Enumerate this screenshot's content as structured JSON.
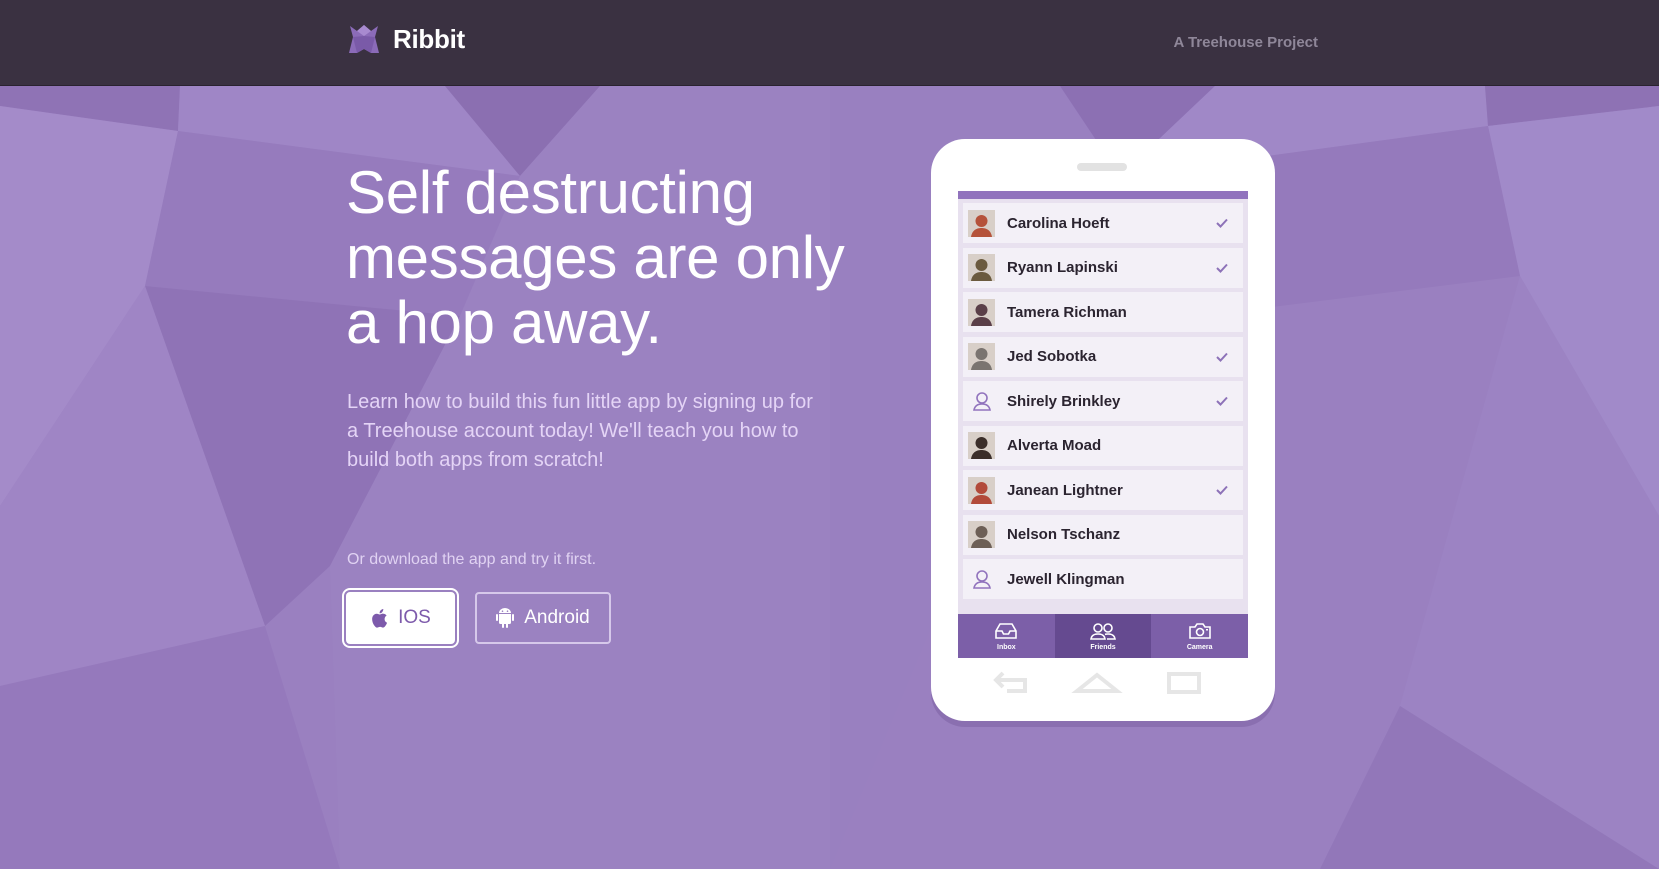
{
  "header": {
    "brand": "Ribbit",
    "tagline": "A Treehouse Project"
  },
  "hero": {
    "title": "Self destructing messages are only a hop away.",
    "description": "Learn how to build this fun little app by signing up for a Treehouse account today! We'll teach you how to build both apps from scratch!",
    "download_text": "Or download the app and try it first."
  },
  "buttons": {
    "ios": "IOS",
    "android": "Android"
  },
  "phone": {
    "contacts": [
      {
        "name": "Carolina Hoeft",
        "checked": true,
        "avatar": "photo",
        "color": "#b5523a"
      },
      {
        "name": "Ryann Lapinski",
        "checked": true,
        "avatar": "photo",
        "color": "#6b5a3e"
      },
      {
        "name": "Tamera Richman",
        "checked": false,
        "avatar": "photo",
        "color": "#5a3f48"
      },
      {
        "name": "Jed Sobotka",
        "checked": true,
        "avatar": "photo",
        "color": "#7a7470"
      },
      {
        "name": "Shirely Brinkley",
        "checked": true,
        "avatar": "placeholder",
        "color": "#9173bd"
      },
      {
        "name": "Alverta Moad",
        "checked": false,
        "avatar": "photo",
        "color": "#3b2e2a"
      },
      {
        "name": "Janean Lightner",
        "checked": true,
        "avatar": "photo",
        "color": "#b24a3a"
      },
      {
        "name": "Nelson Tschanz",
        "checked": false,
        "avatar": "photo",
        "color": "#6d5f56"
      },
      {
        "name": "Jewell Klingman",
        "checked": false,
        "avatar": "placeholder",
        "color": "#9173bd"
      }
    ],
    "tabs": [
      {
        "label": "Inbox",
        "icon": "inbox-icon",
        "active": false
      },
      {
        "label": "Friends",
        "icon": "friends-icon",
        "active": true
      },
      {
        "label": "Camera",
        "icon": "camera-icon",
        "active": false
      }
    ]
  },
  "colors": {
    "background": "#9a80c0",
    "topbar": "#3a3141",
    "accent": "#7c5fa8",
    "active_tab": "#654a90"
  }
}
